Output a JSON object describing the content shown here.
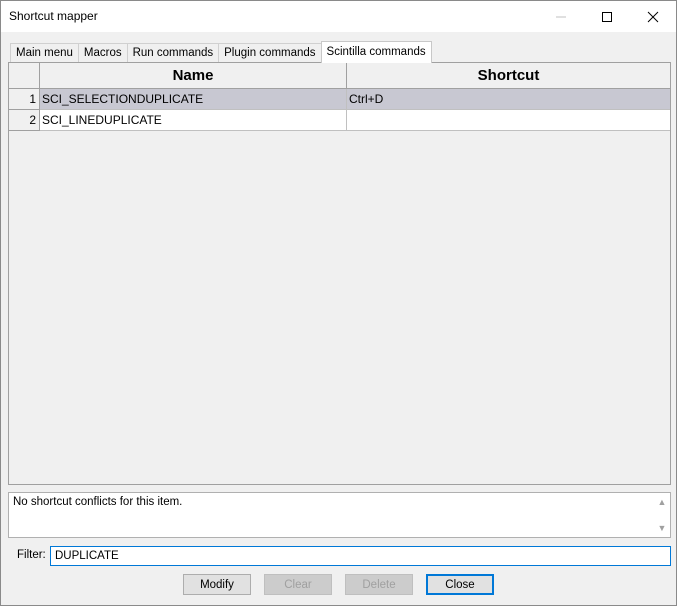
{
  "window": {
    "title": "Shortcut mapper"
  },
  "tabs": [
    {
      "label": "Main menu",
      "active": false
    },
    {
      "label": "Macros",
      "active": false
    },
    {
      "label": "Run commands",
      "active": false
    },
    {
      "label": "Plugin commands",
      "active": false
    },
    {
      "label": "Scintilla commands",
      "active": true
    }
  ],
  "grid": {
    "columns": [
      "Name",
      "Shortcut"
    ],
    "rows": [
      {
        "num": "1",
        "name": "SCI_SELECTIONDUPLICATE",
        "shortcut": "Ctrl+D",
        "selected": true
      },
      {
        "num": "2",
        "name": "SCI_LINEDUPLICATE",
        "shortcut": "",
        "selected": false
      }
    ]
  },
  "conflict": {
    "message": "No shortcut conflicts for this item."
  },
  "filter": {
    "label": "Filter:",
    "value": "DUPLICATE"
  },
  "buttons": {
    "modify": "Modify",
    "clear": "Clear",
    "delete": "Delete",
    "close": "Close"
  },
  "colors": {
    "selection": "#c8c8d2",
    "focus": "#0078d7"
  }
}
